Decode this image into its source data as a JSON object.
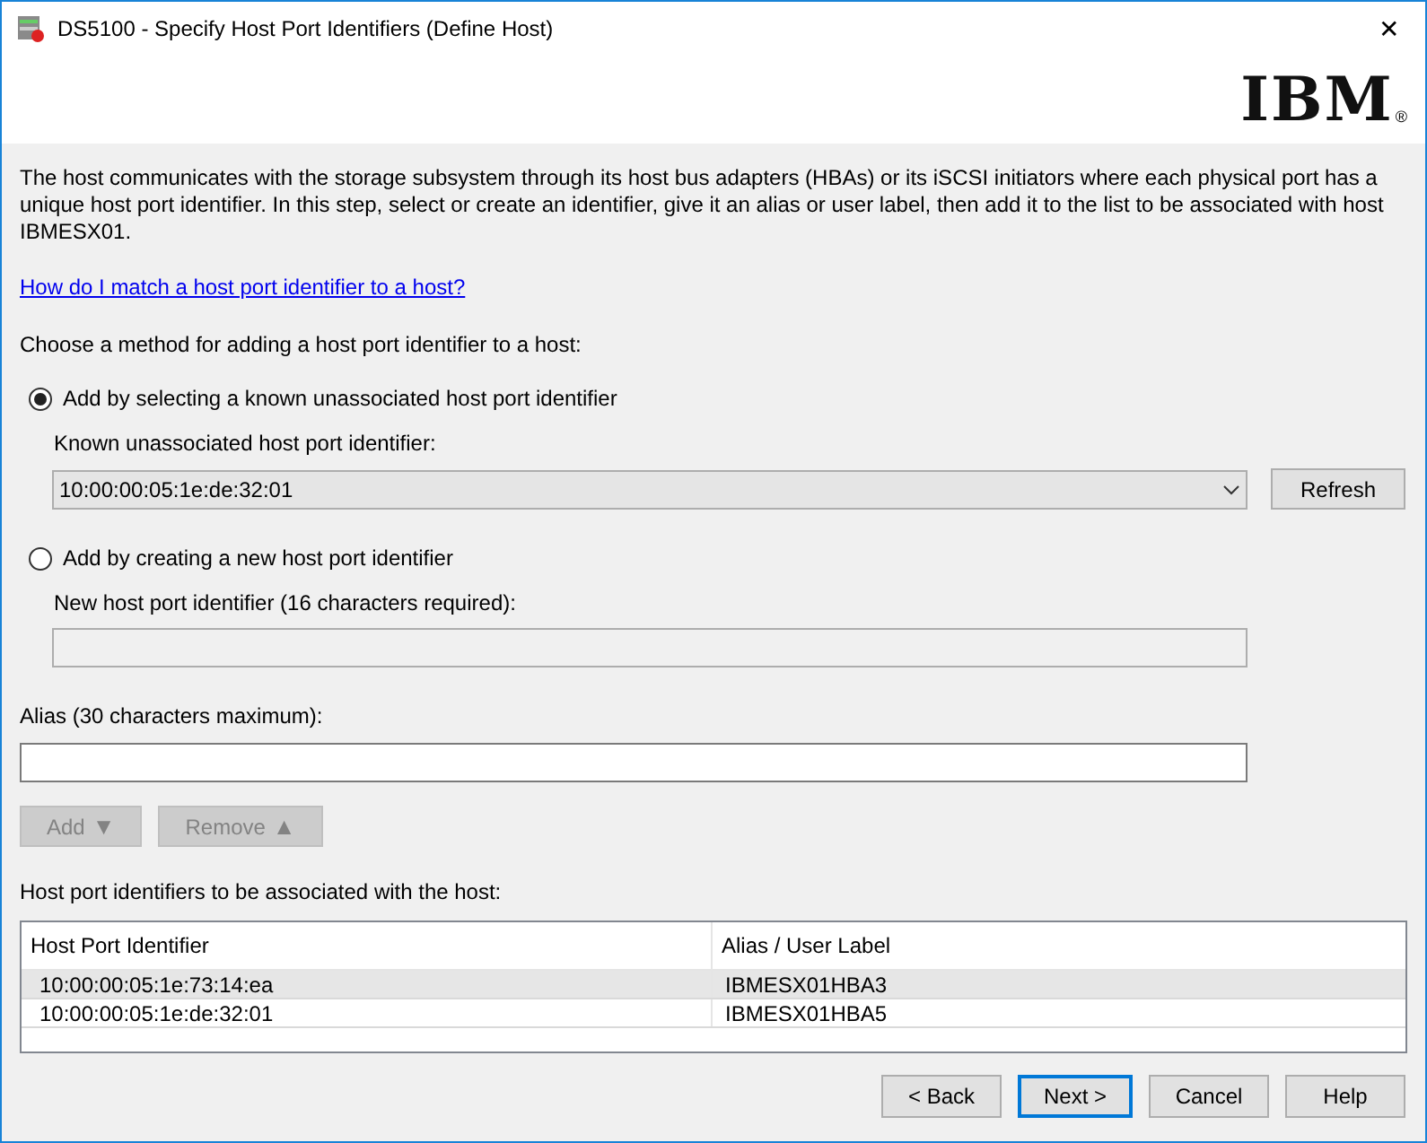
{
  "window": {
    "title": "DS5100 - Specify Host Port Identifiers (Define Host)",
    "close": "✕"
  },
  "logo": {
    "text": "IBM",
    "mark": "®"
  },
  "intro": "The host communicates with the storage subsystem through its host bus adapters (HBAs) or its iSCSI initiators where each physical port has a unique host port identifier. In this step, select or create an identifier, give it an alias or user label, then add it to the list to be associated with host IBMESX01.",
  "help_link": "How do I match a host port identifier to a host?",
  "method_prompt": "Choose a method for adding a host port identifier to a host:",
  "methods": [
    {
      "kind": "select",
      "label": "Add by selecting a known unassociated host port identifier",
      "selected": true,
      "field": {
        "label": "Known unassociated host port identifier:",
        "value": "10:00:00:05:1e:de:32:01"
      },
      "button": "Refresh"
    },
    {
      "kind": "text",
      "label": "Add by creating a new host port identifier",
      "selected": false,
      "field": {
        "label": "New host port identifier (16 characters required):"
      }
    }
  ],
  "alias": {
    "label": "Alias (30 characters maximum):"
  },
  "list_buttons": [
    {
      "label": "Add",
      "arrow": "▼",
      "disabled": true
    },
    {
      "label": "Remove",
      "arrow": "▲",
      "disabled": true
    }
  ],
  "table": {
    "caption": "Host port identifiers to be associated with the host:",
    "columns": [
      "Host Port Identifier",
      "Alias / User Label"
    ],
    "rows": [
      {
        "cells": [
          "10:00:00:05:1e:73:14:ea",
          "IBMESX01HBA3"
        ],
        "selected": true
      },
      {
        "cells": [
          "10:00:00:05:1e:de:32:01",
          "IBMESX01HBA5"
        ],
        "selected": false
      }
    ]
  },
  "footer_buttons": [
    {
      "label": "< Back",
      "default": false
    },
    {
      "label": "Next >",
      "default": true
    },
    {
      "label": "Cancel",
      "default": false
    },
    {
      "label": "Help",
      "default": false
    }
  ]
}
